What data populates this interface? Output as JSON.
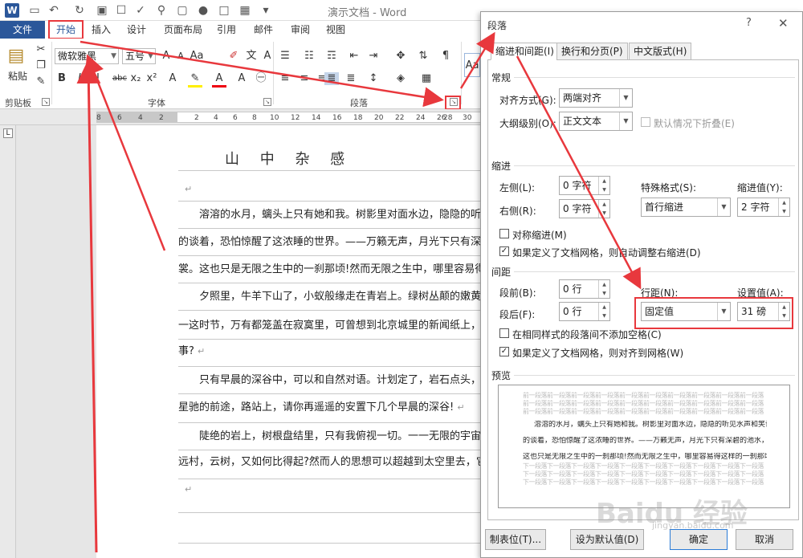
{
  "app": {
    "title": "演示文档 - Word"
  },
  "ribbon": {
    "tabs": [
      "文件",
      "开始",
      "插入",
      "设计",
      "页面布局",
      "引用",
      "邮件",
      "审阅",
      "视图"
    ],
    "clipboard": {
      "paste_label": "粘贴",
      "group_label": "剪贴板"
    },
    "font": {
      "font_name": "微软雅黑",
      "font_size": "五号",
      "group_label": "字体"
    },
    "paragraph": {
      "group_label": "段落"
    },
    "style_preview": "Aa"
  },
  "ruler": {
    "ticks": [
      "8",
      "6",
      "4",
      "2",
      "2",
      "4",
      "6",
      "8",
      "10",
      "12",
      "14",
      "16",
      "18",
      "20",
      "22",
      "24",
      "26",
      "28",
      "30"
    ],
    "tab_selector": "L"
  },
  "document": {
    "heading": "山 中 杂 感",
    "lines": [
      "溶溶的水月，螭头上只有她和我。树影里对面水边，隐隐的听见水声",
      "的谈着，恐怕惊醒了这浓睡的世界。——万籁无声，月光下只有深碧的池",
      "裳。这也只是无限之生中的一刹那顷!然而无限之生中，哪里容易得这样",
      "夕照里，牛羊下山了，小蚁般缘走在青岩上。绿树丛颠的嫩黄叶子，",
      "一这时节，万有都笼盖在寂寞里，可曾想到北京城里的新闻纸上，花花绿",
      "事?",
      "只有早晨的深谷中，可以和自然对语。计划定了，岩石点头，草花欢",
      "星驰的前途，路站上，请你再遥遥的安置下几个早晨的深谷!",
      "陡绝的岩上，树根盘结里，只有我俯视一切。一一无限的宇宙里，",
      "远村，云树，又如何比得起?然而人的思想可以超越到太空里去，它们却"
    ],
    "para_mark": "↵"
  },
  "dialog": {
    "title": "段落",
    "help": "?",
    "close": "✕",
    "tabs": [
      "缩进和间距(I)",
      "换行和分页(P)",
      "中文版式(H)"
    ],
    "general": {
      "section": "常规",
      "alignment_label": "对齐方式(G):",
      "alignment_value": "两端对齐",
      "outline_label": "大纲级别(O):",
      "outline_value": "正文文本",
      "collapse_label": "默认情况下折叠(E)"
    },
    "indent": {
      "section": "缩进",
      "left_label": "左侧(L):",
      "left_value": "0 字符",
      "right_label": "右侧(R):",
      "right_value": "0 字符",
      "special_label": "特殊格式(S):",
      "special_value": "首行缩进",
      "by_label": "缩进值(Y):",
      "by_value": "2 字符",
      "mirror_label": "对称缩进(M)",
      "auto_adjust_label": "如果定义了文档网格，则自动调整右缩进(D)"
    },
    "spacing": {
      "section": "间距",
      "before_label": "段前(B):",
      "before_value": "0 行",
      "after_label": "段后(F):",
      "after_value": "0 行",
      "line_spacing_label": "行距(N):",
      "line_spacing_value": "固定值",
      "at_label": "设置值(A):",
      "at_value": "31 磅",
      "no_space_label": "在相同样式的段落间不添加空格(C)",
      "snap_grid_label": "如果定义了文档网格，则对齐到网格(W)"
    },
    "preview": {
      "section": "预览",
      "gray_before": "前一段落前一段落前一段落前一段落前一段落前一段落前一段落前一段落前一段落前一段落",
      "sample_1": "溶溶的水月，螭头上只有她和我。树影里对面水边，隐隐的听见水声和笑语。我们微微",
      "sample_2": "的谈着，恐怕惊醒了这浓睡的世界。——万籁无声，月光下只有深碧的池水，玲珑的衣裳。",
      "sample_3": "这也只是无限之生中的一刹那顷!然而无限之生中，哪里容易得这样的一刹那顷!",
      "gray_after": "下一段落下一段落下一段落下一段落下一段落下一段落下一段落下一段落下一段落下一段落"
    },
    "buttons": {
      "tabs": "制表位(T)...",
      "default": "设为默认值(D)",
      "ok": "确定",
      "cancel": "取消"
    }
  },
  "watermark": {
    "brand": "Baidu 经验",
    "url": "jingyan.baidu.com"
  },
  "colors": {
    "word_blue": "#2b579a",
    "highlight_red": "#e8383d"
  }
}
